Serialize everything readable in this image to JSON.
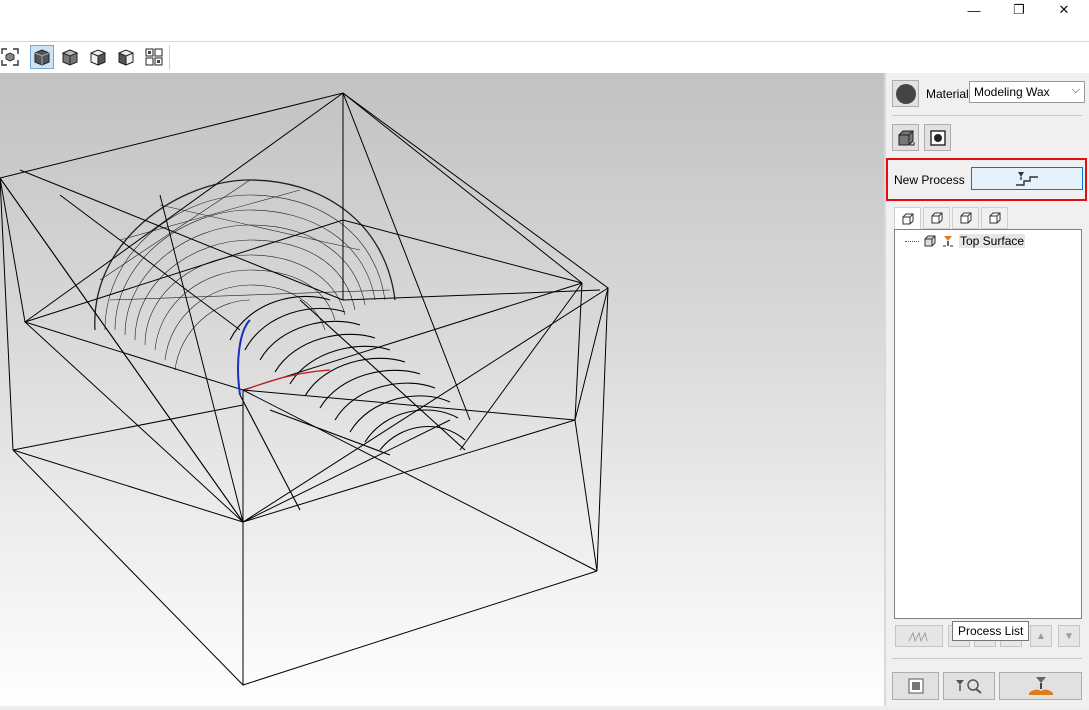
{
  "window": {
    "minimize_icon": "minimize-icon",
    "restore_icon": "restore-icon",
    "close_icon": "close-icon",
    "minimize_glyph": "—",
    "restore_glyph": "❐",
    "close_glyph": "✕"
  },
  "toolbar": {
    "items": [
      "fit-view-icon",
      "iso-view-icon",
      "front-view-icon",
      "side-view-icon",
      "top-view-icon",
      "multi-view-icon"
    ],
    "selected": "iso-view-icon"
  },
  "panel": {
    "material_label": "Material",
    "material_value": "Modeling Wax",
    "new_process_label": "New Process",
    "tree_item_label": "Top Surface",
    "tooltip": "Process List",
    "accent_highlight": "#e01010",
    "accent_selected": "#0078d7"
  }
}
